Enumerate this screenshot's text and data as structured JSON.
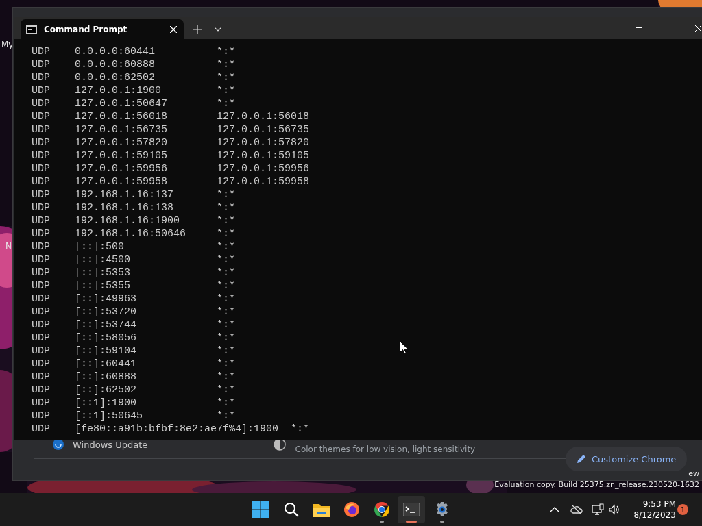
{
  "desktop": {
    "icon_labels": [
      "My",
      "N"
    ],
    "watermark": [
      "ew",
      "Evaluation copy. Build 25375.zn_release.230520-1632"
    ]
  },
  "browser_window": {
    "cards": [
      {
        "kind": "update",
        "label": "Windows Update"
      },
      {
        "kind": "theme",
        "label": "Color themes for low vision, light sensitivity"
      }
    ],
    "customize_button": "Customize Chrome"
  },
  "terminal": {
    "tabs": [
      {
        "title": "Command Prompt",
        "selected": true
      }
    ],
    "lines": [
      {
        "proto": "UDP",
        "local": "0.0.0.0:60441",
        "foreign": "*:*"
      },
      {
        "proto": "UDP",
        "local": "0.0.0.0:60888",
        "foreign": "*:*"
      },
      {
        "proto": "UDP",
        "local": "0.0.0.0:62502",
        "foreign": "*:*"
      },
      {
        "proto": "UDP",
        "local": "127.0.0.1:1900",
        "foreign": "*:*"
      },
      {
        "proto": "UDP",
        "local": "127.0.0.1:50647",
        "foreign": "*:*"
      },
      {
        "proto": "UDP",
        "local": "127.0.0.1:56018",
        "foreign": "127.0.0.1:56018"
      },
      {
        "proto": "UDP",
        "local": "127.0.0.1:56735",
        "foreign": "127.0.0.1:56735"
      },
      {
        "proto": "UDP",
        "local": "127.0.0.1:57820",
        "foreign": "127.0.0.1:57820"
      },
      {
        "proto": "UDP",
        "local": "127.0.0.1:59105",
        "foreign": "127.0.0.1:59105"
      },
      {
        "proto": "UDP",
        "local": "127.0.0.1:59956",
        "foreign": "127.0.0.1:59956"
      },
      {
        "proto": "UDP",
        "local": "127.0.0.1:59958",
        "foreign": "127.0.0.1:59958"
      },
      {
        "proto": "UDP",
        "local": "192.168.1.16:137",
        "foreign": "*:*"
      },
      {
        "proto": "UDP",
        "local": "192.168.1.16:138",
        "foreign": "*:*"
      },
      {
        "proto": "UDP",
        "local": "192.168.1.16:1900",
        "foreign": "*:*"
      },
      {
        "proto": "UDP",
        "local": "192.168.1.16:50646",
        "foreign": "*:*"
      },
      {
        "proto": "UDP",
        "local": "[::]:500",
        "foreign": "*:*"
      },
      {
        "proto": "UDP",
        "local": "[::]:4500",
        "foreign": "*:*"
      },
      {
        "proto": "UDP",
        "local": "[::]:5353",
        "foreign": "*:*"
      },
      {
        "proto": "UDP",
        "local": "[::]:5355",
        "foreign": "*:*"
      },
      {
        "proto": "UDP",
        "local": "[::]:49963",
        "foreign": "*:*"
      },
      {
        "proto": "UDP",
        "local": "[::]:53720",
        "foreign": "*:*"
      },
      {
        "proto": "UDP",
        "local": "[::]:53744",
        "foreign": "*:*"
      },
      {
        "proto": "UDP",
        "local": "[::]:58056",
        "foreign": "*:*"
      },
      {
        "proto": "UDP",
        "local": "[::]:59104",
        "foreign": "*:*"
      },
      {
        "proto": "UDP",
        "local": "[::]:60441",
        "foreign": "*:*"
      },
      {
        "proto": "UDP",
        "local": "[::]:60888",
        "foreign": "*:*"
      },
      {
        "proto": "UDP",
        "local": "[::]:62502",
        "foreign": "*:*"
      },
      {
        "proto": "UDP",
        "local": "[::1]:1900",
        "foreign": "*:*"
      },
      {
        "proto": "UDP",
        "local": "[::1]:50645",
        "foreign": "*:*"
      },
      {
        "proto": "UDP",
        "local": "[fe80::a91b:bfbf:8e2:ae7f%4]:1900",
        "foreign": "*:*"
      }
    ]
  },
  "taskbar": {
    "apps": [
      {
        "kind": "start",
        "running": false,
        "active": false
      },
      {
        "kind": "search",
        "running": false,
        "active": false
      },
      {
        "kind": "files",
        "running": false,
        "active": false
      },
      {
        "kind": "firefox",
        "running": false,
        "active": false
      },
      {
        "kind": "chrome",
        "running": true,
        "active": false
      },
      {
        "kind": "terminal",
        "running": true,
        "active": true
      },
      {
        "kind": "settings",
        "running": true,
        "active": false
      }
    ],
    "time": "9:53 PM",
    "date": "8/12/2023",
    "notification_count": "1"
  }
}
